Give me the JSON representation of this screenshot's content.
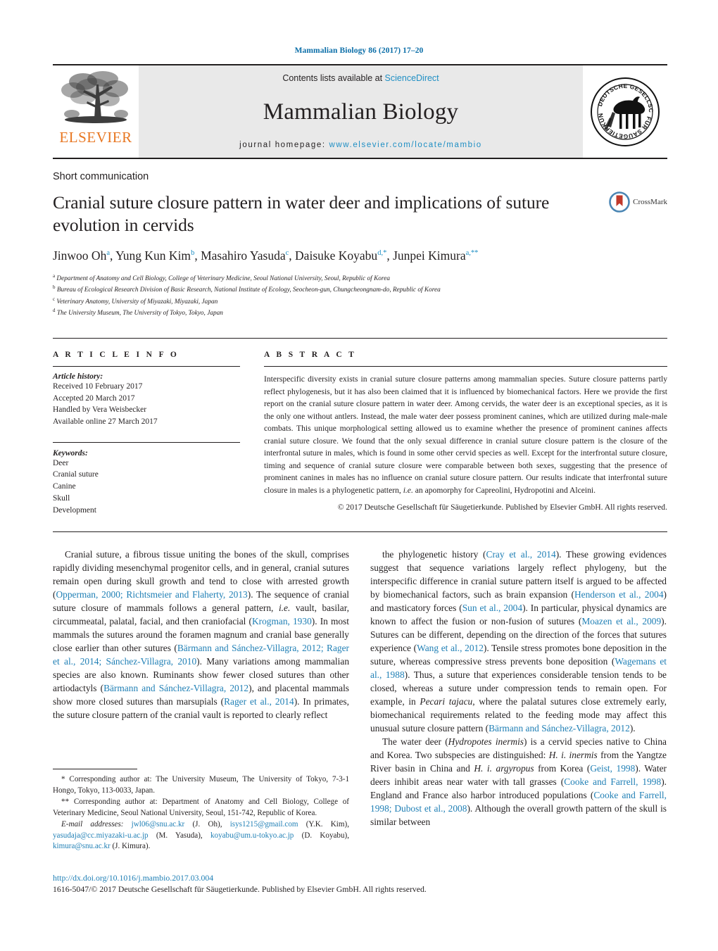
{
  "running_head": "Mammalian Biology 86 (2017) 17–20",
  "masthead": {
    "contents_prefix": "Contents lists available at ",
    "sciencedirect": "ScienceDirect",
    "journal_title": "Mammalian Biology",
    "homepage_prefix": "journal homepage: ",
    "homepage_url": "www.elsevier.com/locate/mambio",
    "publisher_logo_text": "ELSEVIER",
    "society_logo_text": "DEUTSCHE GESELLSCHAFT FÜR SÄUGETIERKUNDE",
    "accent_blue": "#1f8fc4",
    "elsevier_orange": "#e87722"
  },
  "article": {
    "kind": "Short communication",
    "title": "Cranial suture closure pattern in water deer and implications of suture evolution in cervids",
    "crossmark_label": "CrossMark",
    "authors_html": "Jinwoo Oh<sup>a</sup>, Yung Kun Kim<sup>b</sup>, Masahiro Yasuda<sup>c</sup>, Daisuke Koyabu<sup>d,</sup><sup>*</sup>, Junpei Kimura<sup>a,</sup><sup>**</sup>",
    "affiliations": [
      {
        "marker": "a",
        "text": "Department of Anatomy and Cell Biology, College of Veterinary Medicine, Seoul National University, Seoul, Republic of Korea"
      },
      {
        "marker": "b",
        "text": "Bureau of Ecological Research Division of Basic Research, National Institute of Ecology, Seocheon-gun, Chungcheongnam-do, Republic of Korea"
      },
      {
        "marker": "c",
        "text": "Veterinary Anatomy, University of Miyazaki, Miyazaki, Japan"
      },
      {
        "marker": "d",
        "text": "The University Museum, The University of Tokyo, Tokyo, Japan"
      }
    ]
  },
  "article_info": {
    "heading": "A R T I C L E  I N F O",
    "history_label": "Article history:",
    "history": [
      "Received 10 February 2017",
      "Accepted 20 March 2017",
      "Handled by Vera Weisbecker",
      "Available online 27 March 2017"
    ],
    "keywords_label": "Keywords:",
    "keywords": [
      "Deer",
      "Cranial suture",
      "Canine",
      "Skull",
      "Development"
    ]
  },
  "abstract": {
    "heading": "A B S T R A C T",
    "text": "Interspecific diversity exists in cranial suture closure patterns among mammalian species. Suture closure patterns partly reflect phylogenesis, but it has also been claimed that it is influenced by biomechanical factors. Here we provide the first report on the cranial suture closure pattern in water deer. Among cervids, the water deer is an exceptional species, as it is the only one without antlers. Instead, the male water deer possess prominent canines, which are utilized during male-male combats. This unique morphological setting allowed us to examine whether the presence of prominent canines affects cranial suture closure. We found that the only sexual difference in cranial suture closure pattern is the closure of the interfrontal suture in males, which is found in some other cervid species as well. Except for the interfrontal suture closure, timing and sequence of cranial suture closure were comparable between both sexes, suggesting that the presence of prominent canines in males has no influence on cranial suture closure pattern. Our results indicate that interfrontal suture closure in males is a phylogenetic pattern, i.e. an apomorphy for Capreolini, Hydropotini and Alceini.",
    "copyright": "© 2017 Deutsche Gesellschaft für Säugetierkunde. Published by Elsevier GmbH. All rights reserved."
  },
  "body": {
    "left_paragraph_1": "Cranial suture, a fibrous tissue uniting the bones of the skull, comprises rapidly dividing mesenchymal progenitor cells, and in general, cranial sutures remain open during skull growth and tend to close with arrested growth (Opperman, 2000; Richtsmeier and Flaherty, 2013). The sequence of cranial suture closure of mammals follows a general pattern, i.e. vault, basilar, circummeatal, palatal, facial, and then craniofacial (Krogman, 1930). In most mammals the sutures around the foramen magnum and cranial base generally close earlier than other sutures (Bärmann and Sánchez-Villagra, 2012; Rager et al., 2014; Sánchez-Villagra, 2010). Many variations among mammalian species are also known. Ruminants show fewer closed sutures than other artiodactyls (Bärmann and Sánchez-Villagra, 2012), and placental mammals show more closed sutures than marsupials (Rager et al., 2014). In primates, the suture closure pattern of the cranial vault is reported to clearly reflect",
    "right_paragraph_1": "the phylogenetic history (Cray et al., 2014). These growing evidences suggest that sequence variations largely reflect phylogeny, but the interspecific difference in cranial suture pattern itself is argued to be affected by biomechanical factors, such as brain expansion (Henderson et al., 2004) and masticatory forces (Sun et al., 2004). In particular, physical dynamics are known to affect the fusion or non-fusion of sutures (Moazen et al., 2009). Sutures can be different, depending on the direction of the forces that sutures experience (Wang et al., 2012). Tensile stress promotes bone deposition in the suture, whereas compressive stress prevents bone deposition (Wagemans et al., 1988). Thus, a suture that experiences considerable tension tends to be closed, whereas a suture under compression tends to remain open. For example, in Pecari tajacu, where the palatal sutures close extremely early, biomechanical requirements related to the feeding mode may affect this unusual suture closure pattern (Bärmann and Sánchez-Villagra, 2012).",
    "right_paragraph_2": "The water deer (Hydropotes inermis) is a cervid species native to China and Korea. Two subspecies are distinguished: H. i. inermis from the Yangtze River basin in China and H. i. argyropus from Korea (Geist, 1998). Water deers inhibit areas near water with tall grasses (Cooke and Farrell, 1998). England and France also harbor introduced populations (Cooke and Farrell, 1998; Dubost et al., 2008). Although the overall growth pattern of the skull is similar between"
  },
  "footnotes": {
    "star1": "* Corresponding author at: The University Museum, The University of Tokyo, 7-3-1 Hongo, Tokyo, 113-0033, Japan.",
    "star2": "** Corresponding author at: Department of Anatomy and Cell Biology, College of Veterinary Medicine, Seoul National University, Seoul, 151-742, Republic of Korea.",
    "email_label": "E-mail addresses:",
    "emails": [
      {
        "address": "jwl06@snu.ac.kr",
        "person": "(J. Oh)"
      },
      {
        "address": "isys1215@gmail.com",
        "person": "(Y.K. Kim)"
      },
      {
        "address": "yasudaja@cc.miyazaki-u.ac.jp",
        "person": "(M. Yasuda)"
      },
      {
        "address": "koyabu@um.u-tokyo.ac.jp",
        "person": "(D. Koyabu)"
      },
      {
        "address": "kimura@snu.ac.kr",
        "person": "(J. Kimura)"
      }
    ]
  },
  "doi": {
    "url": "http://dx.doi.org/10.1016/j.mambio.2017.03.004",
    "issn_line": "1616-5047/© 2017 Deutsche Gesellschaft für Säugetierkunde. Published by Elsevier GmbH. All rights reserved."
  }
}
